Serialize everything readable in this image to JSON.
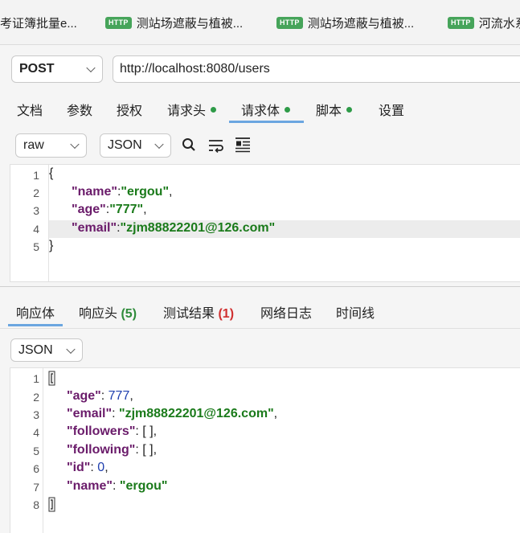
{
  "request_tabs": [
    {
      "label": "考证簿批量e...",
      "badge": ""
    },
    {
      "label": "测站场遮蔽与植被...",
      "badge": "HTTP"
    },
    {
      "label": "测站场遮蔽与植被...",
      "badge": "HTTP"
    },
    {
      "label": "河流水系",
      "badge": "HTTP"
    }
  ],
  "method": "POST",
  "url": "http://localhost:8080/users",
  "nav_tabs": [
    {
      "label": "文档",
      "dot": false
    },
    {
      "label": "参数",
      "dot": false
    },
    {
      "label": "授权",
      "dot": false
    },
    {
      "label": "请求头",
      "dot": true
    },
    {
      "label": "请求体",
      "dot": true,
      "active": true
    },
    {
      "label": "脚本",
      "dot": true
    },
    {
      "label": "设置",
      "dot": false
    }
  ],
  "body_mode": "raw",
  "body_format": "JSON",
  "request_body": {
    "line_numbers": [
      "1",
      "2",
      "3",
      "4",
      "5"
    ],
    "open_brace": "{",
    "close_brace": "}",
    "name_key": "\"name\"",
    "name_val": "\"ergou\"",
    "age_key": "\"age\"",
    "age_val": "\"777\"",
    "email_key": "\"email\"",
    "email_val": "\"zjm88822201@126.com\""
  },
  "response_tabs": {
    "body": "响应体",
    "headers": "响应头",
    "headers_count": "(5)",
    "tests": "测试结果",
    "tests_count": "(1)",
    "network": "网络日志",
    "timeline": "时间线"
  },
  "response_format": "JSON",
  "response_body": {
    "line_numbers": [
      "1",
      "2",
      "3",
      "4",
      "5",
      "6",
      "7",
      "8"
    ],
    "age_key": "\"age\"",
    "age_val": "777",
    "email_key": "\"email\"",
    "email_val": "\"zjm88822201@126.com\"",
    "followers_key": "\"followers\"",
    "followers_val": "[ ]",
    "following_key": "\"following\"",
    "following_val": "[ ]",
    "id_key": "\"id\"",
    "id_val": "0",
    "name_key": "\"name\"",
    "name_val": "\"ergou\""
  },
  "colors": {
    "accent_underline": "#6ba6e0",
    "dot_green": "#2e9b48",
    "count_red": "#d03030"
  }
}
